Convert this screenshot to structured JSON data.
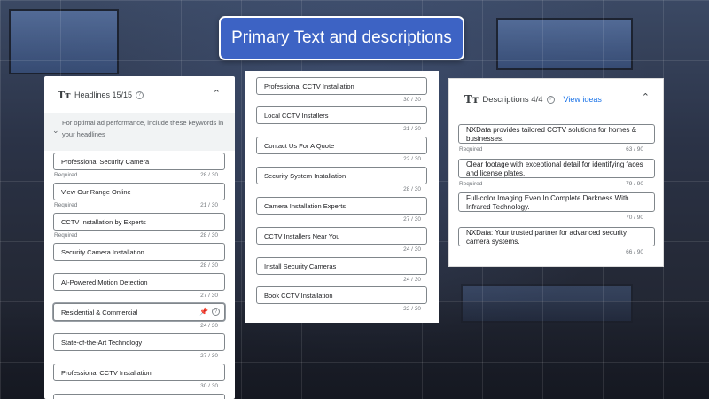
{
  "banner": {
    "title": "Primary Text and descriptions"
  },
  "headlines": {
    "title": "Headlines 15/15",
    "hint": "For optimal ad performance, include these keywords in your headlines",
    "items": [
      {
        "text": "Professional Security Camera",
        "count": "28 / 30",
        "required": "Required"
      },
      {
        "text": "View Our Range Online",
        "count": "21 / 30",
        "required": "Required"
      },
      {
        "text": "CCTV Installation by Experts",
        "count": "28 / 30",
        "required": "Required"
      },
      {
        "text": "Security Camera Installation",
        "count": "28 / 30",
        "required": ""
      },
      {
        "text": "AI-Powered Motion Detection",
        "count": "27 / 30",
        "required": ""
      },
      {
        "text": "Residential & Commercial",
        "count": "24 / 30",
        "required": ""
      },
      {
        "text": "State-of-the-Art Technology",
        "count": "27 / 30",
        "required": ""
      },
      {
        "text": "Professional CCTV Installation",
        "count": "30 / 30",
        "required": ""
      }
    ]
  },
  "headlines_continued": {
    "items": [
      {
        "text": "Professional CCTV Installation",
        "count": "30 / 30"
      },
      {
        "text": "Local CCTV Installers",
        "count": "21 / 30"
      },
      {
        "text": "Contact Us For A Quote",
        "count": "22 / 30"
      },
      {
        "text": "Security System Installation",
        "count": "28 / 30"
      },
      {
        "text": "Camera Installation Experts",
        "count": "27 / 30"
      },
      {
        "text": "CCTV Installers Near You",
        "count": "24 / 30"
      },
      {
        "text": "Install Security Cameras",
        "count": "24 / 30"
      },
      {
        "text": "Book CCTV Installation",
        "count": "22 / 30"
      }
    ]
  },
  "descriptions": {
    "title": "Descriptions 4/4",
    "view_ideas": "View ideas",
    "items": [
      {
        "text": "NXData provides tailored CCTV solutions for homes & businesses.",
        "count": "63 / 90",
        "required": "Required"
      },
      {
        "text": "Clear footage with exceptional detail for identifying faces and license plates.",
        "count": "79 / 90",
        "required": "Required"
      },
      {
        "text": "Full-color Imaging Even In Complete Darkness With Infrared Technology.",
        "count": "70 / 90",
        "required": ""
      },
      {
        "text": "NXData: Your trusted partner for advanced security camera systems.",
        "count": "66 / 90",
        "required": ""
      }
    ]
  }
}
